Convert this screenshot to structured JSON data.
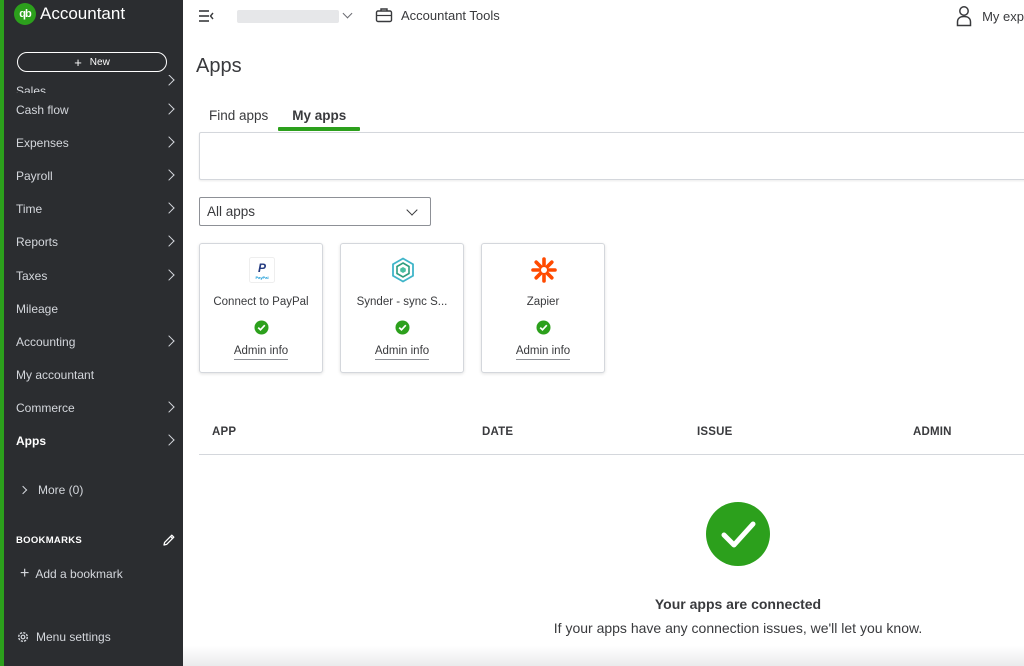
{
  "sidebar": {
    "brand": "Accountant",
    "brand_logo_text": "qb",
    "new_label": "New",
    "items": [
      {
        "label": "Sales",
        "chevron": true
      },
      {
        "label": "Cash flow",
        "chevron": true
      },
      {
        "label": "Expenses",
        "chevron": true
      },
      {
        "label": "Payroll",
        "chevron": true
      },
      {
        "label": "Time",
        "chevron": true
      },
      {
        "label": "Reports",
        "chevron": true
      },
      {
        "label": "Taxes",
        "chevron": true
      },
      {
        "label": "Mileage",
        "chevron": false
      },
      {
        "label": "Accounting",
        "chevron": true
      },
      {
        "label": "My accountant",
        "chevron": false
      },
      {
        "label": "Commerce",
        "chevron": true
      },
      {
        "label": "Apps",
        "chevron": true,
        "active": true
      }
    ],
    "more_label": "More (0)",
    "bookmarks_header": "BOOKMARKS",
    "add_bookmark_label": "Add a bookmark",
    "menu_settings_label": "Menu settings",
    "accent_color": "#2ca01c",
    "bg_color": "#2b2d30"
  },
  "topbar": {
    "tools_label": "Accountant Tools",
    "user_label": "My exp"
  },
  "main": {
    "title": "Apps",
    "tabs": [
      {
        "label": "Find apps",
        "active": false
      },
      {
        "label": "My apps",
        "active": true
      }
    ],
    "filter": {
      "selected": "All apps"
    },
    "apps": [
      {
        "name": "Connect to PayPal",
        "logo": "paypal-logo",
        "status": "connected",
        "admin_label": "Admin info"
      },
      {
        "name": "Synder - sync S...",
        "logo": "synder-logo",
        "status": "connected",
        "admin_label": "Admin info"
      },
      {
        "name": "Zapier",
        "logo": "zapier-logo",
        "status": "connected",
        "admin_label": "Admin info"
      }
    ],
    "table": {
      "columns": [
        "APP",
        "DATE",
        "ISSUE",
        "ADMIN"
      ]
    },
    "empty_state": {
      "title": "Your apps are connected",
      "subtitle": "If your apps have any connection issues, we'll let you know."
    }
  },
  "colors": {
    "brand_green": "#2ca01c",
    "status_green": "#2ca01c",
    "zapier_orange": "#ff4a00",
    "paypal_blue": "#253b80"
  }
}
